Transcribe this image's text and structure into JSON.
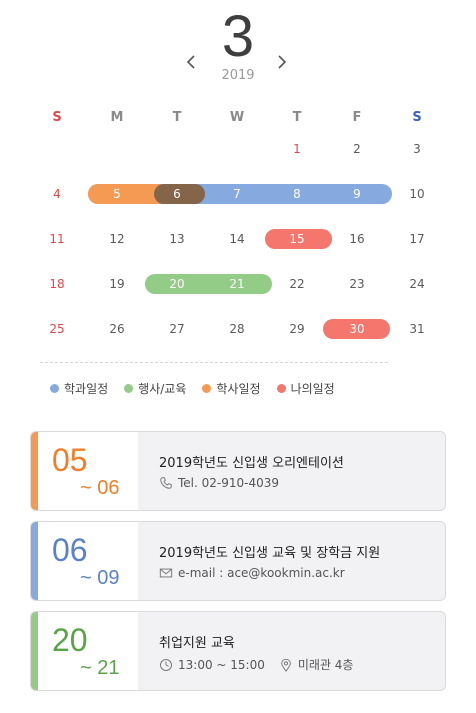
{
  "header": {
    "month": "3",
    "year": "2019",
    "prev_icon": "chevron-left-icon",
    "next_icon": "chevron-right-icon"
  },
  "weekdays": [
    "S",
    "M",
    "T",
    "W",
    "T",
    "F",
    "S"
  ],
  "weeks": [
    [
      "",
      "",
      "",
      "",
      "1",
      "2",
      "3"
    ],
    [
      "4",
      "5",
      "6",
      "7",
      "8",
      "9",
      "10"
    ],
    [
      "11",
      "12",
      "13",
      "14",
      "15",
      "16",
      "17"
    ],
    [
      "18",
      "19",
      "20",
      "21",
      "22",
      "23",
      "24"
    ],
    [
      "25",
      "26",
      "27",
      "28",
      "29",
      "30",
      "31"
    ]
  ],
  "colors": {
    "academic": "#86a9e0",
    "event": "#93cc86",
    "schedule": "#f59a52",
    "mine": "#f4766d",
    "highlight": "#84654a",
    "sunday": "#e04848",
    "saturday": "#3c5fc4"
  },
  "legend": [
    {
      "label": "학과일정",
      "color": "#86a9e0"
    },
    {
      "label": "행사/교육",
      "color": "#93cc86"
    },
    {
      "label": "학사일정",
      "color": "#f59a52"
    },
    {
      "label": "나의일정",
      "color": "#f4766d"
    }
  ],
  "events": [
    {
      "start": "05",
      "end": "~ 06",
      "color": "#f59a52",
      "title": "2019학년도 신입생 오리엔테이션",
      "info": [
        {
          "icon": "phone-icon",
          "text": "Tel. 02-910-4039"
        }
      ]
    },
    {
      "start": "06",
      "end": "~ 09",
      "color": "#86a9e0",
      "title": "2019학년도 신입생 교육 및 장학금 지원",
      "info": [
        {
          "icon": "mail-icon",
          "text": "e-mail : ace@kookmin.ac.kr"
        }
      ]
    },
    {
      "start": "20",
      "end": "~ 21",
      "color": "#7fbf6a",
      "title": "취업지원 교육",
      "info": [
        {
          "icon": "clock-icon",
          "text": "13:00 ~ 15:00"
        },
        {
          "icon": "location-pin-icon",
          "text": "미래관 4층"
        }
      ]
    }
  ]
}
